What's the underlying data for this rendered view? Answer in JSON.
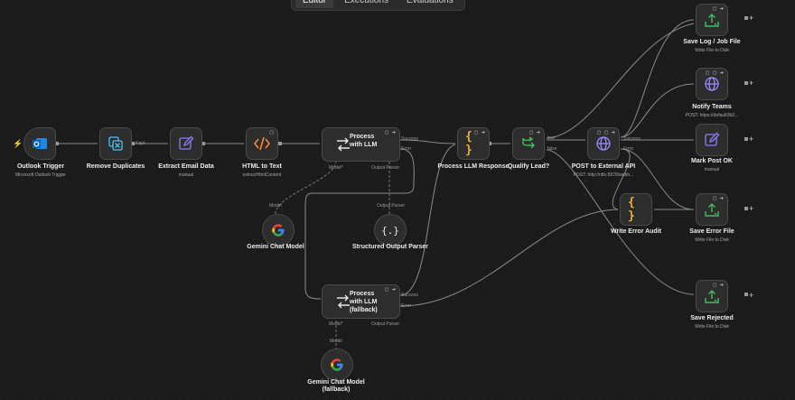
{
  "tabs": [
    "Editor",
    "Executions",
    "Evaluations"
  ],
  "nodes": {
    "outlook": {
      "title": "Outlook Trigger",
      "subtitle": "Microsoft Outlook Trigger"
    },
    "dedupe": {
      "title": "Remove Duplicates"
    },
    "extract": {
      "title": "Extract Email Data",
      "subtitle": "manual"
    },
    "html": {
      "title": "HTML to Text",
      "subtitle": "extractHtmlContent"
    },
    "llm": {
      "title": "Process with LLM",
      "port_model": "Model*",
      "port_parser": "Output Parser",
      "port_success": "Success",
      "port_error": "Error"
    },
    "gemini": {
      "title": "Gemini Chat Model",
      "port_model": "Model"
    },
    "parser": {
      "title": "Structured Output Parser",
      "port_parser": "Output Parser"
    },
    "llm_fb": {
      "title": "Process with LLM (fallback)",
      "port_model": "Model*",
      "port_parser": "Output Parser",
      "port_success": "Success",
      "port_error": "Error"
    },
    "gemini_fb": {
      "title": "Gemini Chat Model (fallback)",
      "port_model": "Model"
    },
    "process_resp": {
      "title": "Process LLM Response"
    },
    "qualify": {
      "title": "Qualify Lead?",
      "port_true": "true",
      "port_false": "false"
    },
    "post_api": {
      "title": "POST to External API",
      "subtitle": "POST: http://n8n:5678/webh...",
      "port_success": "Success",
      "port_error": "Error"
    },
    "save_log": {
      "title": "Save Log / Job File",
      "subtitle": "Write File to Disk"
    },
    "notify": {
      "title": "Notify Teams",
      "subtitle": "POST: https://default3b2..."
    },
    "mark_post": {
      "title": "Mark Post OK",
      "subtitle": "manual"
    },
    "write_error": {
      "title": "Write Error Audit"
    },
    "save_error": {
      "title": "Save Error File",
      "subtitle": "Write File to Disk"
    },
    "save_rejected": {
      "title": "Save Rejected",
      "subtitle": "Write File to Disk"
    }
  },
  "edge_labels": {
    "dedupe_kept": "Kept"
  },
  "icons": {
    "outlook": "outlook-icon",
    "dedupe": "remove-duplicates-icon",
    "extract": "edit-icon",
    "html": "code-icon",
    "llm": "llm-chain-icon",
    "gemini": "google-icon",
    "parser": "json-braces-icon",
    "code": "code-braces-icon",
    "branch": "if-branch-icon",
    "http": "globe-icon",
    "file": "file-write-icon"
  },
  "colors": {
    "accent_orange": "#ff6d3a",
    "edit_purple": "#8b7cf6",
    "file_green": "#3fbf62",
    "braces_yellow": "#f2b233",
    "http_purple": "#9b8cff"
  }
}
